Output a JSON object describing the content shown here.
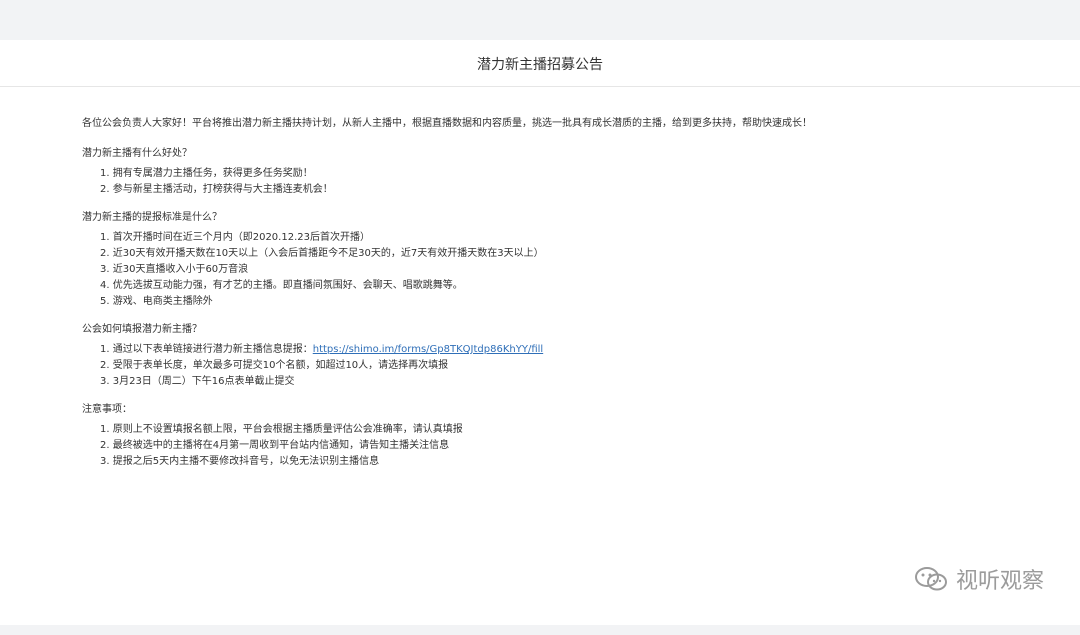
{
  "page": {
    "title": "潜力新主播招募公告"
  },
  "content": {
    "intro": "各位公会负责人大家好！平台将推出潜力新主播扶持计划，从新人主播中，根据直播数据和内容质量，挑选一批具有成长潜质的主播，给到更多扶持，帮助快速成长！",
    "sections": [
      {
        "title": "潜力新主播有什么好处？",
        "items": [
          "1. 拥有专属潜力主播任务，获得更多任务奖励！",
          "2. 参与新星主播活动，打榜获得与大主播连麦机会！"
        ]
      },
      {
        "title": "潜力新主播的提报标准是什么？",
        "items": [
          "1. 首次开播时间在近三个月内（即2020.12.23后首次开播）",
          "2. 近30天有效开播天数在10天以上（入会后首播距今不足30天的，近7天有效开播天数在3天以上）",
          "3. 近30天直播收入小于60万音浪",
          "4. 优先选拔互动能力强，有才艺的主播。即直播间氛围好、会聊天、唱歌跳舞等。",
          "5. 游戏、电商类主播除外"
        ]
      },
      {
        "title": "公会如何填报潜力新主播？",
        "items_link": {
          "prefix": "1. 通过以下表单链接进行潜力新主播信息提报：",
          "url": "https://shimo.im/forms/Gp8TKQJtdp86KhYY/fill"
        },
        "items": [
          "2. 受限于表单长度，单次最多可提交10个名额，如超过10人，请选择再次填报",
          "3. 3月23日（周二）下午16点表单截止提交"
        ]
      },
      {
        "title": "注意事项：",
        "items": [
          "1. 原则上不设置填报名额上限，平台会根据主播质量评估公会准确率，请认真填报",
          "2. 最终被选中的主播将在4月第一周收到平台站内信通知，请告知主播关注信息",
          "3. 提报之后5天内主播不要修改抖音号，以免无法识别主播信息"
        ]
      }
    ]
  },
  "watermark": {
    "text": "视听观察",
    "icon": "wechat-icon"
  },
  "colors": {
    "background": "#f2f3f5",
    "panel": "#ffffff",
    "text": "#333333",
    "link": "#2f6fb8",
    "watermark": "#9b9b9b"
  }
}
